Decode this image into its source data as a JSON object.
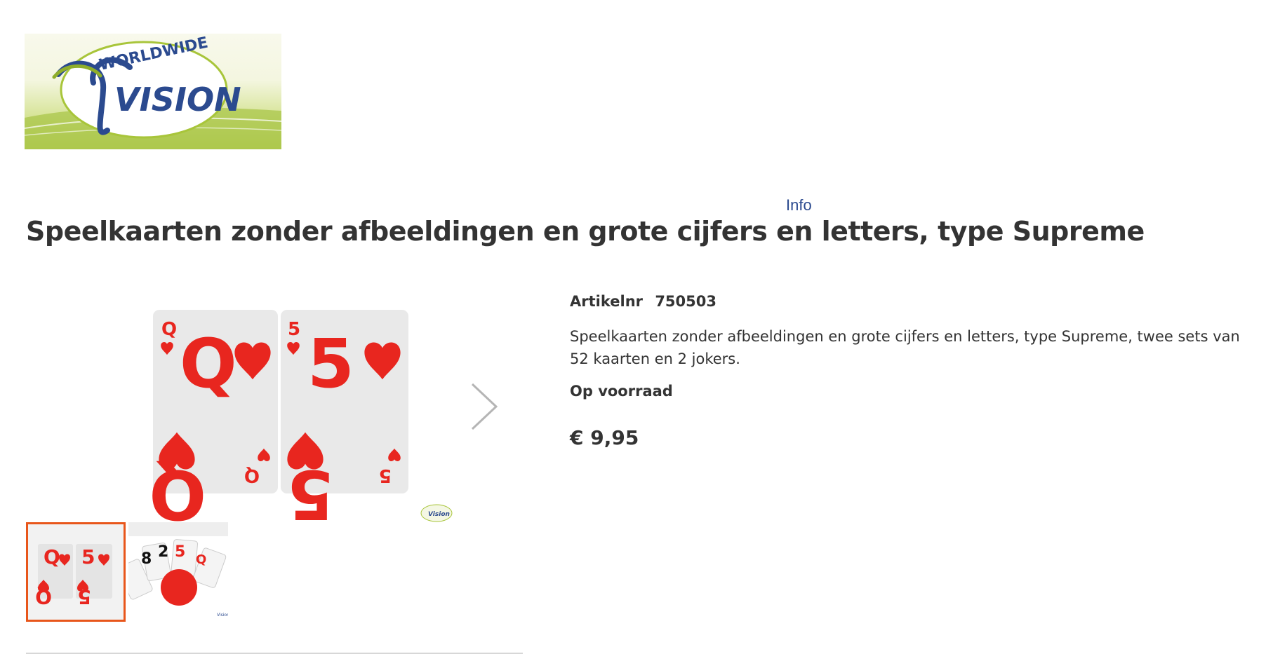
{
  "header": {
    "logo": {
      "text_top": "WORLDWIDE",
      "text_main": "VISION"
    },
    "info_link": "Info"
  },
  "product": {
    "title": "Speelkaarten zonder afbeeldingen en grote cijfers en letters, type Supreme",
    "article_label": "Artikelnr",
    "article_number": "750503",
    "description": "Speelkaarten zonder afbeeldingen en grote cijfers en letters, type Supreme, twee sets van 52 kaarten en 2 jokers.",
    "stock_status": "Op voorraad",
    "price": "€ 9,95"
  },
  "gallery": {
    "main_cards": [
      {
        "rank": "Q",
        "suit": "♥"
      },
      {
        "rank": "5",
        "suit": "♥"
      }
    ],
    "thumbnails": [
      "thumbnail-cards-q-5",
      "thumbnail-cards-fan"
    ],
    "active_index": 0,
    "next_icon": "chevron-right-icon"
  },
  "colors": {
    "card_red": "#e8261f",
    "accent_orange": "#e8561b",
    "logo_blue": "#2b4a8f",
    "logo_green": "#9bbd2f"
  }
}
